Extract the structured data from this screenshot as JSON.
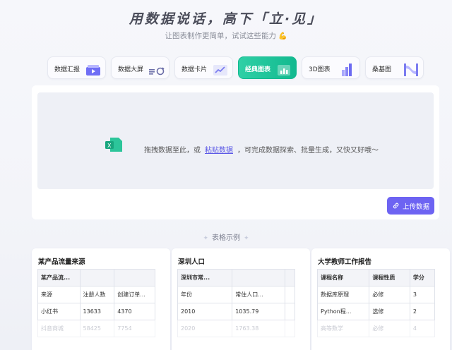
{
  "hero": {
    "title": "用数据说话，高下「立·见」",
    "subtitle": "让图表制作更简单，试试这些能力",
    "subtitle_icon": "flexed-arm-icon"
  },
  "tabs": [
    {
      "label": "数据汇报",
      "icon": "report-chart-icon",
      "active": false
    },
    {
      "label": "数据大屏",
      "icon": "big-screen-icon",
      "active": false
    },
    {
      "label": "数据卡片",
      "icon": "data-card-icon",
      "active": false
    },
    {
      "label": "经典图表",
      "icon": "classic-chart-icon",
      "active": true
    },
    {
      "label": "3D图表",
      "icon": "3d-chart-icon",
      "active": false
    },
    {
      "label": "桑基图",
      "icon": "sankey-icon",
      "active": false
    }
  ],
  "upload": {
    "prefix": "拖拽数据至此，或",
    "paste_link": "粘贴数据",
    "suffix": "，可完成数据探索、批量生成，又快又好哦～",
    "button": "上传数据"
  },
  "examples": {
    "title": "表格示例",
    "cards": [
      {
        "title": "某产品流量来源",
        "header": [
          "某产品流...",
          "",
          ""
        ],
        "rows": [
          [
            "来源",
            "注册人数",
            "创建订单..."
          ],
          [
            "小红书",
            "13633",
            "4370"
          ]
        ],
        "faded": [
          "抖音商城",
          "58425",
          "7754"
        ]
      },
      {
        "title": "深圳人口",
        "header": [
          "深圳市常...",
          "",
          ""
        ],
        "rows": [
          [
            "年份",
            "常住人口...",
            ""
          ],
          [
            "2010",
            "1035.79",
            ""
          ]
        ],
        "faded": [
          "2020",
          "1763.38",
          ""
        ]
      },
      {
        "title": "大学教师工作报告",
        "header": [
          "课程名称",
          "课程性质",
          "学分"
        ],
        "rows": [
          [
            "数据库原理",
            "必修",
            "3"
          ],
          [
            "Python程...",
            "选修",
            "2"
          ]
        ],
        "faded": [
          "高等数学",
          "必修",
          "4"
        ]
      }
    ]
  },
  "colors": {
    "accent": "#6d63f2",
    "active_tab": "#12b98f",
    "link": "#5b58e6"
  }
}
